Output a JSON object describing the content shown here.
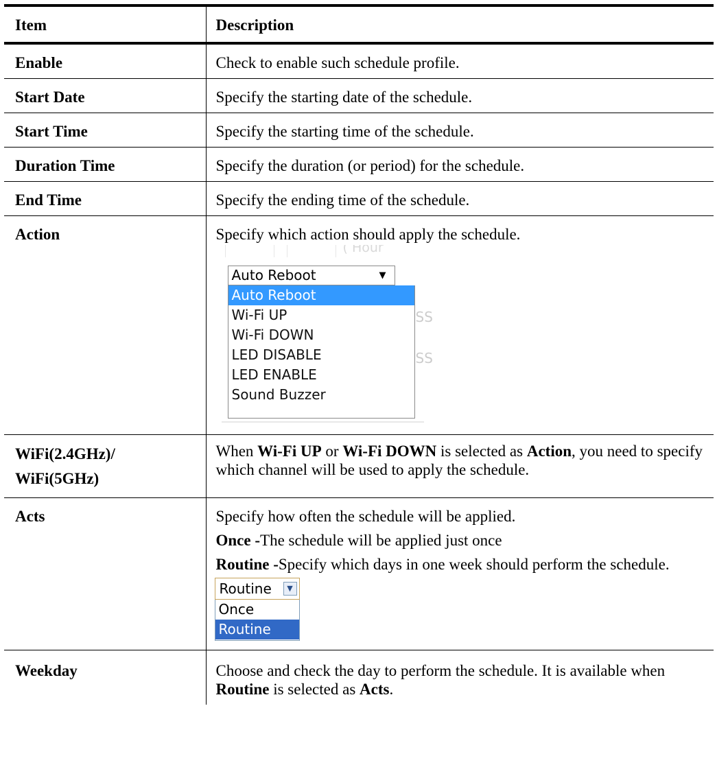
{
  "header": {
    "item": "Item",
    "description": "Description"
  },
  "rows": {
    "enable": {
      "item": "Enable",
      "desc": "Check to enable such schedule profile."
    },
    "start_date": {
      "item": "Start Date",
      "desc": "Specify the starting date of the schedule."
    },
    "start_time": {
      "item": "Start Time",
      "desc": "Specify the starting time of the schedule."
    },
    "duration_time": {
      "item": "Duration Time",
      "desc": "Specify the duration (or period) for the schedule."
    },
    "end_time": {
      "item": "End Time",
      "desc": "Specify the ending time of the schedule."
    },
    "action": {
      "item": "Action",
      "desc": "Specify which action should apply the schedule.",
      "dropdown": {
        "selected": "Auto Reboot",
        "options": [
          "Auto Reboot",
          "Wi-Fi UP",
          "Wi-Fi DOWN",
          "LED DISABLE",
          "LED ENABLE",
          "Sound Buzzer"
        ],
        "highlight_color": "#3399ff"
      }
    },
    "wifi": {
      "item_line1": "WiFi(2.4GHz)/",
      "item_line2": "WiFi(5GHz)",
      "d1": "When ",
      "d2": "Wi-Fi UP",
      "d3": " or ",
      "d4": "Wi-Fi DOWN",
      "d5": " is selected as ",
      "d6": "Action",
      "d7": ", you need to specify which channel will be used to apply the schedule."
    },
    "acts": {
      "item": "Acts",
      "p1": "Specify how often the schedule will be applied.",
      "once_label": "Once -",
      "once_text": "The schedule will be applied just once",
      "routine_label": "Routine -",
      "routine_text": "Specify which days in one week should perform the schedule.",
      "dropdown": {
        "selected": "Routine",
        "options": [
          "Once",
          "Routine"
        ],
        "highlight_color": "#3169c6"
      }
    },
    "weekday": {
      "item": "Weekday",
      "d1": "Choose and check the day to perform the schedule. It is available when ",
      "d2": "Routine",
      "d3": " is selected as ",
      "d4": "Acts",
      "d5": "."
    }
  }
}
